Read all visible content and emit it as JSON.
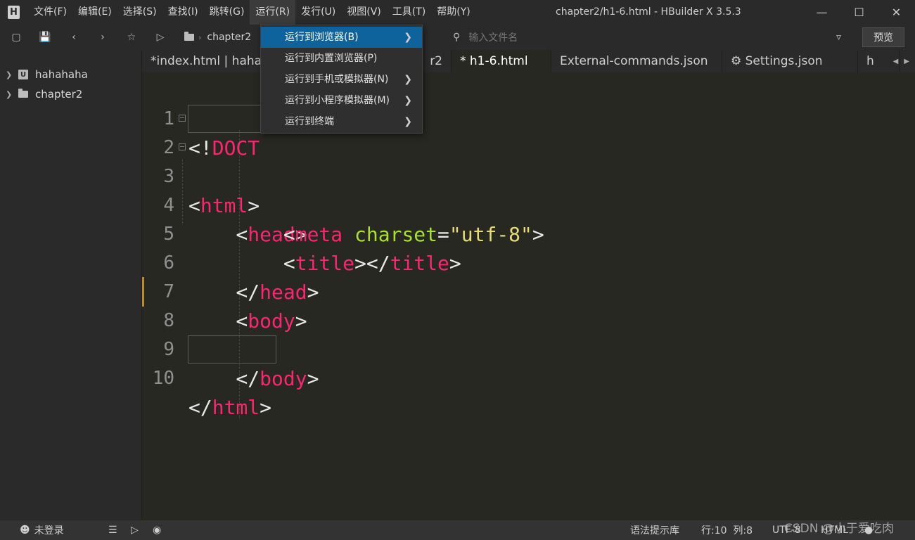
{
  "app": {
    "title": "chapter2/h1-6.html - HBuilder X 3.5.3",
    "logo_letter": "H"
  },
  "menubar": {
    "items": [
      "文件(F)",
      "编辑(E)",
      "选择(S)",
      "查找(I)",
      "跳转(G)",
      "运行(R)",
      "发行(U)",
      "视图(V)",
      "工具(T)",
      "帮助(Y)"
    ],
    "active_index": 5
  },
  "toolbar": {
    "breadcrumb": "chapter2",
    "search_placeholder": "输入文件名",
    "preview_label": "预览"
  },
  "run_menu": {
    "items": [
      {
        "label": "运行到浏览器(B)",
        "submenu": true,
        "highlighted": true
      },
      {
        "label": "运行到内置浏览器(P)",
        "submenu": false,
        "highlighted": false
      },
      {
        "label": "运行到手机或模拟器(N)",
        "submenu": true,
        "highlighted": false
      },
      {
        "label": "运行到小程序模拟器(M)",
        "submenu": true,
        "highlighted": false
      },
      {
        "label": "运行到终端",
        "submenu": true,
        "highlighted": false
      }
    ]
  },
  "sidebar": {
    "projects": [
      {
        "label": "hahahaha",
        "icon": "uniapp-project-icon"
      },
      {
        "label": "chapter2",
        "icon": "folder-icon"
      }
    ]
  },
  "tabs": [
    {
      "label": "*index.html | hahahaha",
      "active": false
    },
    {
      "label": "r2",
      "active": false
    },
    {
      "label": "* h1-6.html",
      "active": true
    },
    {
      "label": "External-commands.json",
      "active": false
    },
    {
      "label": "⚙ Settings.json",
      "active": false
    },
    {
      "label": "h",
      "active": false
    }
  ],
  "editor": {
    "line_numbers": [
      "1",
      "2",
      "3",
      "4",
      "5",
      "6",
      "7",
      "8",
      "9",
      "10"
    ],
    "code": {
      "l1": "DOCT",
      "l2": "html",
      "l3": "head",
      "l4_tag": "meta",
      "l4_attr": "charset",
      "l4_val": "\"utf-8\"",
      "l5": "title",
      "l6": "head",
      "l7": "body",
      "l9": "body",
      "l10": "html"
    }
  },
  "statusbar": {
    "login": "未登录",
    "syntax_hint": "语法提示库",
    "position": "行:10  列:8",
    "encoding": "UTF-8",
    "language": "HTML"
  },
  "watermark": "CSDN @小于爱吃肉",
  "colors": {
    "background": "#272822",
    "tag": "#f92672",
    "attribute": "#a6e22e",
    "string": "#e6db74",
    "menu_highlight": "#0e639c"
  }
}
